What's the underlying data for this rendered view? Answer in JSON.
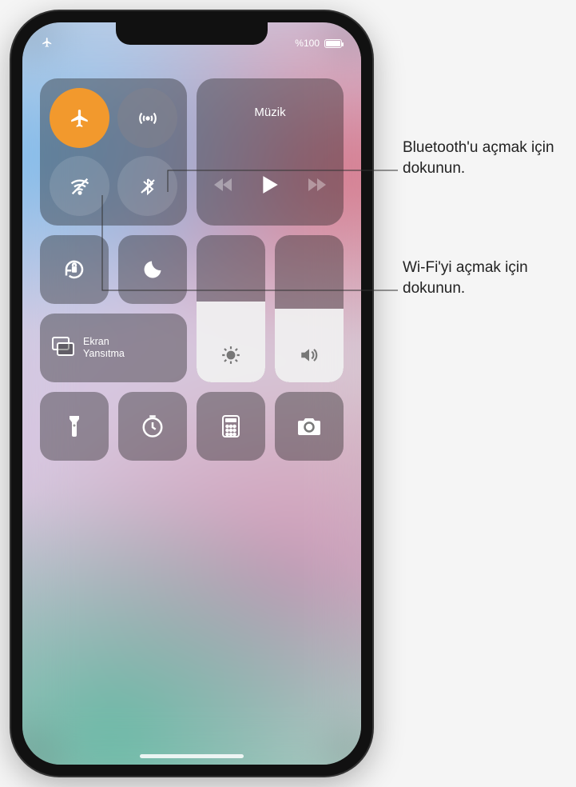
{
  "status": {
    "battery_pct_text": "%100"
  },
  "connectivity": {
    "airplane_on": true
  },
  "music": {
    "title": "Müzik"
  },
  "screen_mirror": {
    "label_line1": "Ekran",
    "label_line2": "Yansıtma"
  },
  "sliders": {
    "brightness_pct": 55,
    "volume_pct": 50
  },
  "callouts": {
    "bluetooth": "Bluetooth'u açmak için dokunun.",
    "wifi": "Wi-Fi'yi açmak için dokunun."
  }
}
